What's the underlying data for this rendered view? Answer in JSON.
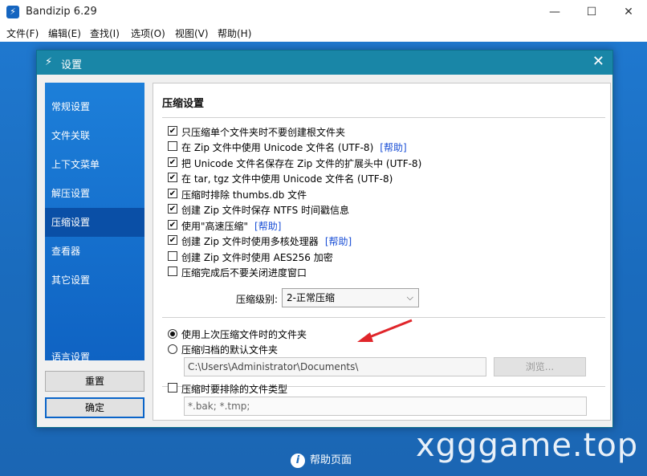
{
  "app": {
    "title": "Bandizip 6.29",
    "window_min": "—",
    "window_max": "☐",
    "window_close": "✕"
  },
  "menu": [
    "文件(F)",
    "编辑(E)",
    "查找(I)",
    "选项(O)",
    "视图(V)",
    "帮助(H)"
  ],
  "dialog": {
    "title": "设置",
    "close": "✕"
  },
  "sidebar": {
    "items": [
      "常规设置",
      "文件关联",
      "上下文菜单",
      "解压设置",
      "压缩设置",
      "查看器",
      "其它设置",
      "语言设置"
    ],
    "selected_index": 4
  },
  "buttons": {
    "reset": "重置",
    "ok": "确定"
  },
  "panel": {
    "title": "压缩设置",
    "options": [
      {
        "label": "只压缩单个文件夹时不要创建根文件夹",
        "checked": true,
        "link": ""
      },
      {
        "label": "在 Zip 文件中使用 Unicode 文件名 (UTF-8)",
        "checked": false,
        "link": "[帮助]"
      },
      {
        "label": "把 Unicode 文件名保存在 Zip 文件的扩展头中 (UTF-8)",
        "checked": true,
        "link": ""
      },
      {
        "label": "在 tar, tgz 文件中使用 Unicode 文件名 (UTF-8)",
        "checked": true,
        "link": ""
      },
      {
        "label": "压缩时排除 thumbs.db 文件",
        "checked": true,
        "link": ""
      },
      {
        "label": "创建 Zip 文件时保存 NTFS 时间戳信息",
        "checked": true,
        "link": ""
      },
      {
        "label": "使用\"高速压缩\"",
        "checked": true,
        "link": "[帮助]"
      },
      {
        "label": "创建 Zip 文件时使用多核处理器",
        "checked": true,
        "link": "[帮助]"
      },
      {
        "label": "创建 Zip 文件时使用 AES256 加密",
        "checked": false,
        "link": ""
      },
      {
        "label": "压缩完成后不要关闭进度窗口",
        "checked": false,
        "link": ""
      }
    ],
    "level_label": "压缩级别:",
    "level_value": "2-正常压缩",
    "folder_options": [
      {
        "label": "使用上次压缩文件时的文件夹",
        "selected": true
      },
      {
        "label": "压缩归档的默认文件夹",
        "selected": false
      }
    ],
    "default_folder": "C:\\Users\\Administrator\\Documents\\",
    "browse": "浏览...",
    "exclude_label": "压缩时要排除的文件类型",
    "exclude_checked": false,
    "exclude_value": "*.bak; *.tmp;"
  },
  "footer": {
    "help_label": "帮助页面"
  },
  "watermark": "xgggame.top",
  "colors": {
    "accent": "#1986a7",
    "sidebar": "#1a73d0",
    "link": "#1a4fd6",
    "arrow": "#e0262b"
  }
}
